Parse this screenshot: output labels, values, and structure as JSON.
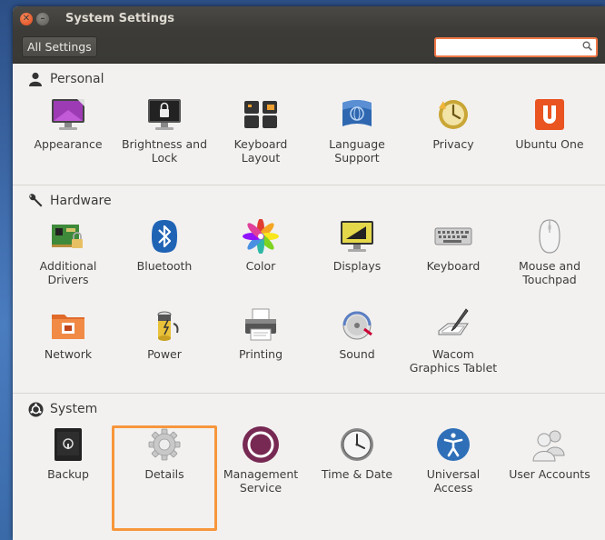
{
  "window": {
    "title": "System Settings"
  },
  "toolbar": {
    "all_settings_label": "All Settings",
    "search_placeholder": ""
  },
  "sections": {
    "personal": {
      "title": "Personal",
      "items": [
        {
          "label": "Appearance",
          "icon": "appearance-icon"
        },
        {
          "label": "Brightness and Lock",
          "icon": "brightness-lock-icon"
        },
        {
          "label": "Keyboard Layout",
          "icon": "keyboard-layout-icon"
        },
        {
          "label": "Language Support",
          "icon": "language-support-icon"
        },
        {
          "label": "Privacy",
          "icon": "privacy-icon"
        },
        {
          "label": "Ubuntu One",
          "icon": "ubuntu-one-icon"
        }
      ]
    },
    "hardware": {
      "title": "Hardware",
      "items": [
        {
          "label": "Additional Drivers",
          "icon": "drivers-icon"
        },
        {
          "label": "Bluetooth",
          "icon": "bluetooth-icon"
        },
        {
          "label": "Color",
          "icon": "color-icon"
        },
        {
          "label": "Displays",
          "icon": "displays-icon"
        },
        {
          "label": "Keyboard",
          "icon": "keyboard-icon"
        },
        {
          "label": "Mouse and Touchpad",
          "icon": "mouse-icon"
        },
        {
          "label": "Network",
          "icon": "network-icon"
        },
        {
          "label": "Power",
          "icon": "power-icon"
        },
        {
          "label": "Printing",
          "icon": "printer-icon"
        },
        {
          "label": "Sound",
          "icon": "sound-icon"
        },
        {
          "label": "Wacom Graphics Tablet",
          "icon": "wacom-icon"
        }
      ]
    },
    "system": {
      "title": "System",
      "items": [
        {
          "label": "Backup",
          "icon": "backup-icon"
        },
        {
          "label": "Details",
          "icon": "details-gear-icon"
        },
        {
          "label": "Management Service",
          "icon": "management-icon"
        },
        {
          "label": "Time & Date",
          "icon": "clock-icon"
        },
        {
          "label": "Universal Access",
          "icon": "accessibility-icon"
        },
        {
          "label": "User Accounts",
          "icon": "users-icon"
        }
      ]
    }
  },
  "colors": {
    "accent": "#f07746",
    "highlight": "#f7963b",
    "titlebar": "#3c3b37"
  }
}
